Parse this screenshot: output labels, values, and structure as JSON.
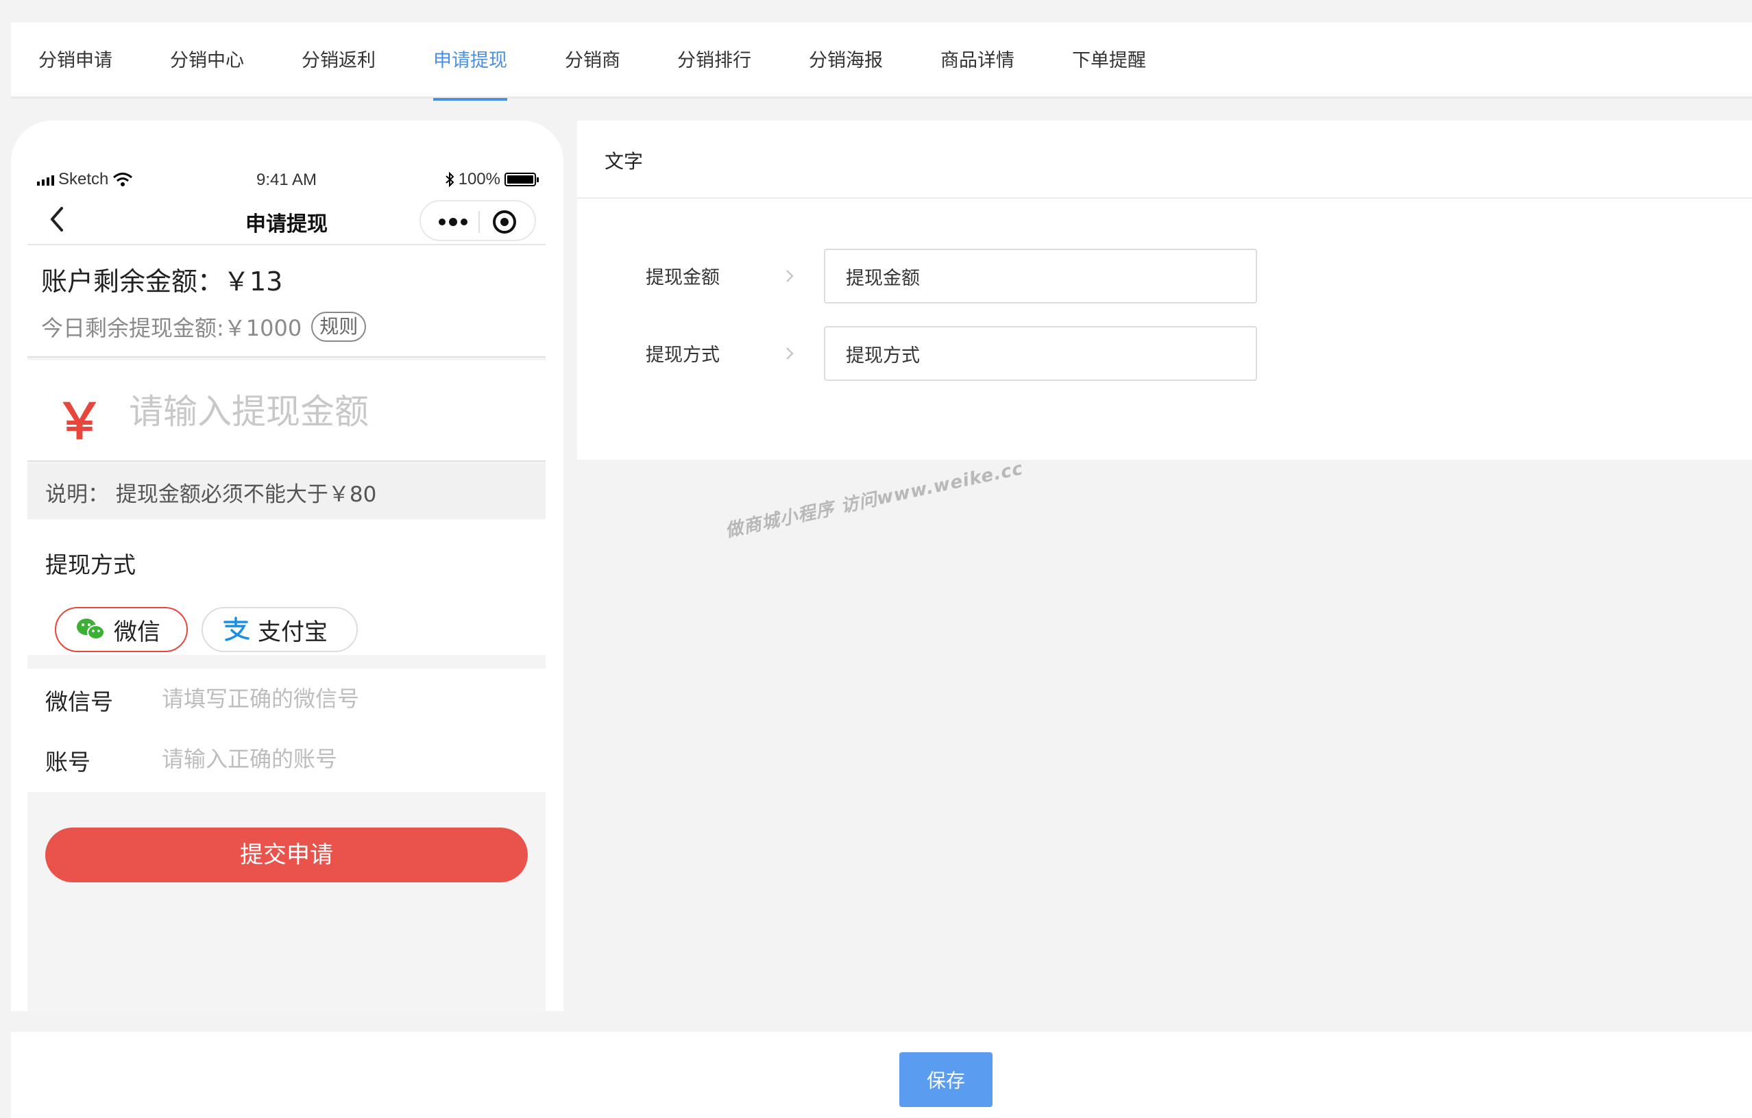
{
  "tabs": [
    {
      "label": "分销申请"
    },
    {
      "label": "分销中心"
    },
    {
      "label": "分销返利"
    },
    {
      "label": "申请提现"
    },
    {
      "label": "分销商"
    },
    {
      "label": "分销排行"
    },
    {
      "label": "分销海报"
    },
    {
      "label": "商品详情"
    },
    {
      "label": "下单提醒"
    }
  ],
  "active_tab": "申请提现",
  "accent_color": "#4a90e2",
  "phone": {
    "status": {
      "carrier": "Sketch",
      "time": "9:41 AM",
      "battery": "100%"
    },
    "nav_title": "申请提现",
    "balance": {
      "main": "账户剩余金额：￥13",
      "sub": "今日剩余提现金额:￥1000",
      "rule_label": "规则"
    },
    "amount": {
      "currency_symbol": "￥",
      "placeholder": "请输入提现金额"
    },
    "note": "说明：  提现金额必须不能大于￥80",
    "method": {
      "title": "提现方式",
      "options": [
        {
          "label": "微信",
          "icon": "wechat-icon",
          "selected": true
        },
        {
          "label": "支付宝",
          "icon": "alipay-icon",
          "selected": false
        }
      ]
    },
    "fields": [
      {
        "label": "微信号",
        "placeholder": "请填写正确的微信号"
      },
      {
        "label": "账号",
        "placeholder": "请输入正确的账号"
      }
    ],
    "submit_label": "提交申请",
    "brand_red": "#ea534b"
  },
  "settings": {
    "header": "文字",
    "rows": [
      {
        "label": "提现金额",
        "value": "提现金额"
      },
      {
        "label": "提现方式",
        "value": "提现方式"
      }
    ]
  },
  "watermark": "做商城小程序 访问www.weike.cc",
  "footer": {
    "save_label": "保存"
  }
}
